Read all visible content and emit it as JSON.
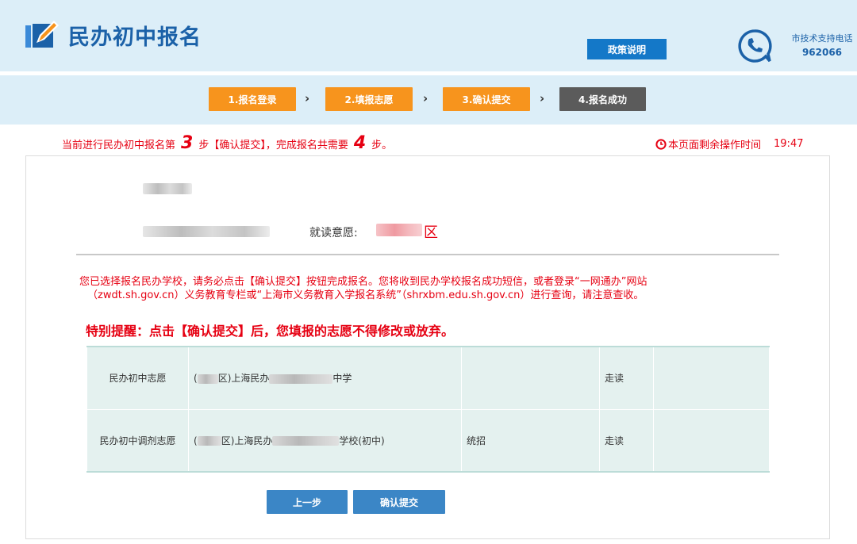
{
  "header": {
    "title": "民办初中报名",
    "policy_button": "政策说明",
    "support_label": "市技术支持电话",
    "support_number": "962066",
    "colors": {
      "primary": "#1b61a8",
      "header_bg": "#dceef8",
      "button": "#1478c8"
    }
  },
  "steps": [
    {
      "label": "1.报名登录",
      "state": "active"
    },
    {
      "label": "2.填报志愿",
      "state": "active"
    },
    {
      "label": "3.确认提交",
      "state": "active"
    },
    {
      "label": "4.报名成功",
      "state": "inactive"
    }
  ],
  "step_separator": "›",
  "status": {
    "prefix": "当前进行民办初中报名第",
    "current_step": "3",
    "middle": "步【确认提交】，完成报名共需要",
    "total_steps": "4",
    "suffix": "步。",
    "timer_label": "本页面剩余操作时间",
    "timer_value": "19:47",
    "color": "#e60012"
  },
  "applicant": {
    "preference_label": "就读意愿:",
    "preference_suffix": "区"
  },
  "notice": {
    "line1": "您已选择报名民办学校，请务必点击【确认提交】按钮完成报名。您将收到民办学校报名成功短信，或者登录“一网通办”网站",
    "line2": "（zwdt.sh.gov.cn）义务教育专栏或“上海市义务教育入学报名系统”（shrxbm.edu.sh.gov.cn）进行查询，请注意查收。",
    "warning": "特别提醒：点击【确认提交】后，您填报的志愿不得修改或放弃。"
  },
  "table": {
    "rows": [
      {
        "label": "民办初中志愿",
        "school_open": "(",
        "school_mid": "区)上海民办",
        "school_end": "中学",
        "type": "",
        "mode": "走读",
        "extra": ""
      },
      {
        "label": "民办初中调剂志愿",
        "school_open": "(",
        "school_mid": "区)上海民办",
        "school_end": "学校(初中)",
        "type": "统招",
        "mode": "走读",
        "extra": ""
      }
    ]
  },
  "actions": {
    "back": "上一步",
    "submit": "确认提交"
  }
}
